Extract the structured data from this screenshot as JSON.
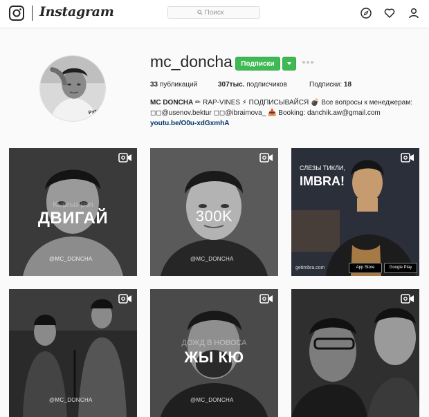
{
  "header": {
    "wordmark": "Instagram",
    "search_placeholder": "Поиск"
  },
  "profile": {
    "username": "mc_doncha",
    "follow_label": "Подписки",
    "avatar_text": "Рэээп",
    "stats": {
      "posts_count": "33",
      "posts_label": "публикаций",
      "followers_count": "307тыс.",
      "followers_label": "подписчиков",
      "following_label": "Подписки:",
      "following_count": "18"
    },
    "bio": {
      "name": "MC DONCHA",
      "line1_rest": "✏ RAP-VINES ⚡ ПОДПИСЫВАЙСЯ 💣 Все вопросы к менеджерам:",
      "line2": "◻◻@usenov.bektur ◻◻@ibraimova_ 📥 Booking: danchik.aw@gmail.com",
      "link": "youtu.be/O0u-xdGxmhA"
    }
  },
  "posts": [
    {
      "caption_small": "Кыргыз рэп",
      "caption_big": "ДВИГАЙ",
      "watermark": "@MC_DONCHA",
      "type": "video"
    },
    {
      "caption_big": "300K",
      "watermark": "@MC_DONCHA",
      "type": "video"
    },
    {
      "caption_small": "СЛЕЗЫ ТИКЛИ,",
      "caption_big": "IMBRA!",
      "footer": "getimbra.com",
      "store1": "App Store",
      "store2": "Google Play",
      "type": "video"
    },
    {
      "watermark": "@MC_DONCHA",
      "type": "video"
    },
    {
      "caption_small": "ДОЖД В НОВОСА",
      "caption_big": "ЖЫ КЮ",
      "watermark": "@MC_DONCHA",
      "type": "video"
    },
    {
      "type": "video"
    }
  ],
  "colors": {
    "follow_green": "#3fb953",
    "link_blue": "#003569"
  }
}
